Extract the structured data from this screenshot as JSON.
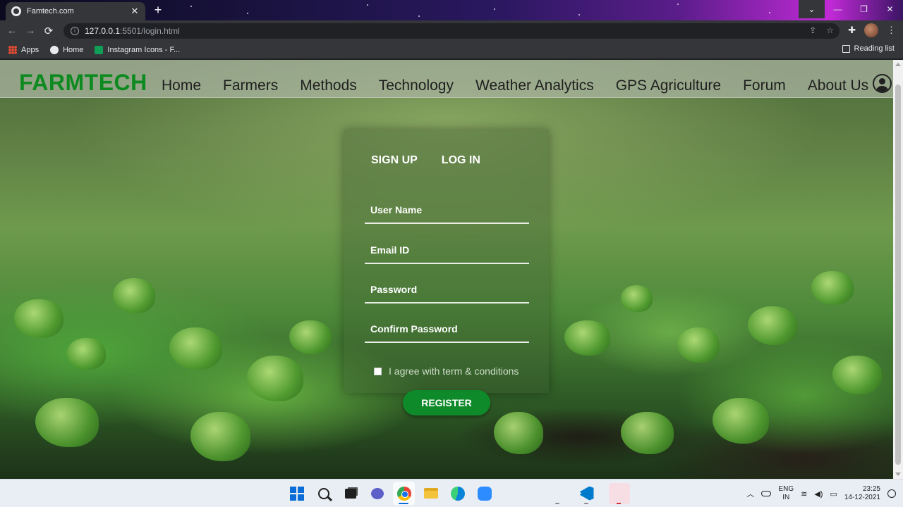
{
  "browser": {
    "tab_title": "Famtech.com",
    "tab_close": "✕",
    "new_tab": "+",
    "url_host": "127.0.0.1",
    "url_rest": ":5501/login.html",
    "bookmarks": [
      "Apps",
      "Home",
      "Instagram Icons - F..."
    ],
    "reading_list": "Reading list",
    "window_controls": [
      "⌄",
      "—",
      "❐",
      "✕"
    ],
    "nav": [
      "←",
      "→",
      "⟳"
    ]
  },
  "site": {
    "logo": "FARMTECH",
    "menu": [
      "Home",
      "Farmers",
      "Methods",
      "Technology",
      "Weather Analytics",
      "GPS Agriculture",
      "Forum",
      "About Us"
    ],
    "brand_color": "#0d8a1f"
  },
  "form": {
    "tabs": [
      "SIGN UP",
      "LOG IN"
    ],
    "fields": [
      {
        "placeholder": "User Name",
        "value": ""
      },
      {
        "placeholder": "Email ID",
        "value": ""
      },
      {
        "placeholder": "Password",
        "value": ""
      },
      {
        "placeholder": "Confirm Password",
        "value": ""
      }
    ],
    "agree_text": "I agree with term & conditions",
    "agree_checked": false,
    "submit_label": "REGISTER",
    "submit_color": "#0f8a2a"
  },
  "taskbar": {
    "lang_top": "ENG",
    "lang_bottom": "IN",
    "time": "23:25",
    "date": "14-12-2021"
  }
}
